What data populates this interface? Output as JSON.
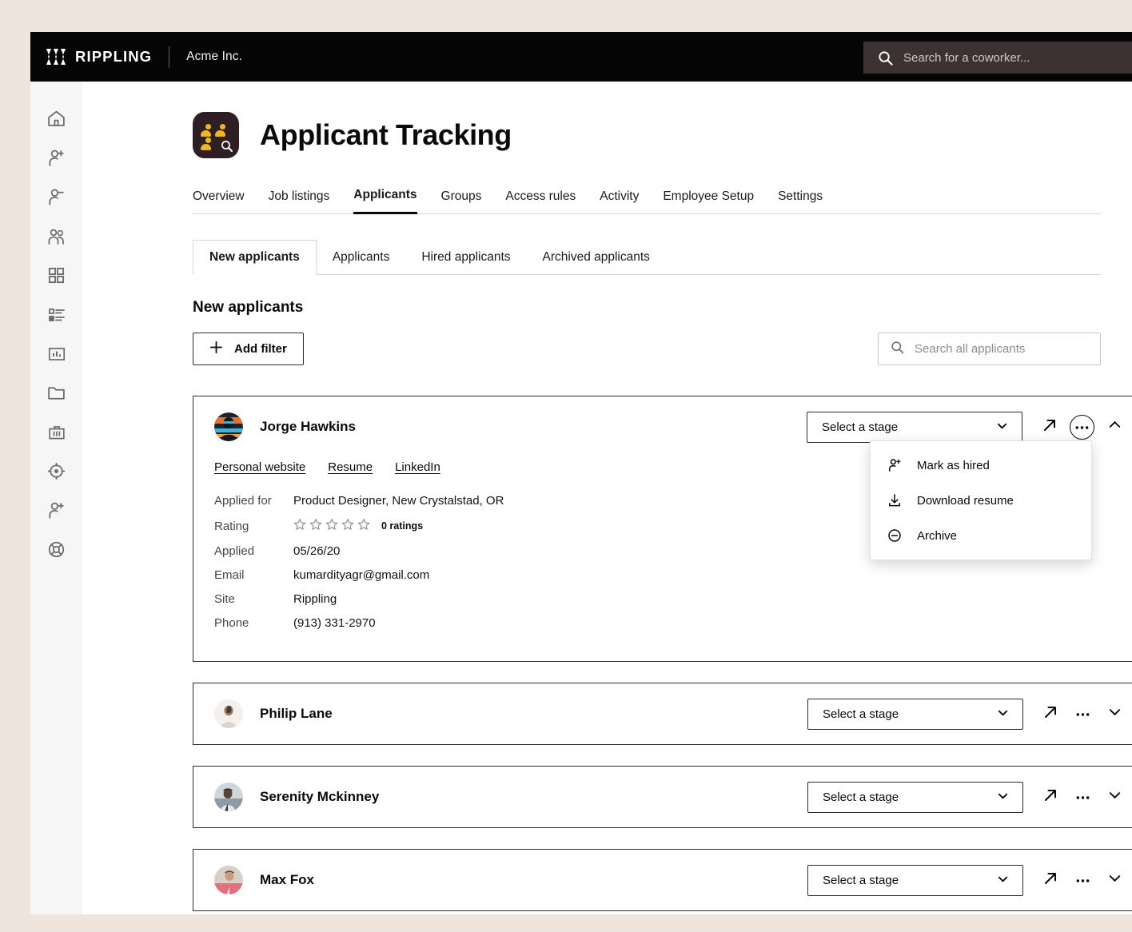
{
  "topbar": {
    "logo_text": "RIPPLING",
    "company": "Acme Inc.",
    "search_placeholder": "Search for a coworker..."
  },
  "sidebar": {
    "items": [
      {
        "name": "home",
        "label": "Home"
      },
      {
        "name": "add-person",
        "label": "Hire"
      },
      {
        "name": "remove-person",
        "label": "Terminate"
      },
      {
        "name": "people",
        "label": "People"
      },
      {
        "name": "apps-grid",
        "label": "Apps"
      },
      {
        "name": "list-tasks",
        "label": "Tasks"
      },
      {
        "name": "reports-chart",
        "label": "Reports"
      },
      {
        "name": "folder",
        "label": "Documents"
      },
      {
        "name": "briefcase",
        "label": "Benefits"
      },
      {
        "name": "target",
        "label": "Goals"
      },
      {
        "name": "add-person-2",
        "label": "Recruiting"
      },
      {
        "name": "lifebuoy",
        "label": "Support"
      }
    ]
  },
  "page": {
    "title": "Applicant Tracking",
    "app_icon_bg": "#2e1f24",
    "app_icon_accent": "#f0b429"
  },
  "nav_tabs": [
    {
      "label": "Overview",
      "active": false
    },
    {
      "label": "Job listings",
      "active": false
    },
    {
      "label": "Applicants",
      "active": true
    },
    {
      "label": "Groups",
      "active": false
    },
    {
      "label": "Access rules",
      "active": false
    },
    {
      "label": "Activity",
      "active": false
    },
    {
      "label": "Employee Setup",
      "active": false
    },
    {
      "label": "Settings",
      "active": false
    }
  ],
  "sub_tabs": [
    {
      "label": "New applicants",
      "active": true
    },
    {
      "label": "Applicants",
      "active": false
    },
    {
      "label": "Hired applicants",
      "active": false
    },
    {
      "label": "Archived applicants",
      "active": false
    }
  ],
  "section": {
    "title": "New applicants",
    "add_filter_label": "Add filter",
    "search_placeholder": "Search all applicants"
  },
  "stage_select_label": "Select a stage",
  "context_menu": {
    "items": [
      {
        "label": "Mark as hired",
        "icon": "person-add-icon"
      },
      {
        "label": "Download resume",
        "icon": "download-icon"
      },
      {
        "label": "Archive",
        "icon": "minus-circle-icon"
      }
    ]
  },
  "applicants": [
    {
      "name": "Jorge Hawkins",
      "expanded": true,
      "links": [
        {
          "label": "Personal website"
        },
        {
          "label": "Resume"
        },
        {
          "label": "LinkedIn"
        }
      ],
      "details": [
        {
          "label": "Applied for",
          "value": "Product Designer, New Crystalstad, OR"
        },
        {
          "label": "Rating",
          "value": "0 ratings",
          "type": "rating",
          "stars": 0,
          "max_stars": 5
        },
        {
          "label": "Applied",
          "value": "05/26/20"
        },
        {
          "label": "Email",
          "value": "kumardityagr@gmail.com"
        },
        {
          "label": "Site",
          "value": "Rippling"
        },
        {
          "label": "Phone",
          "value": "(913) 331-2970"
        }
      ]
    },
    {
      "name": "Philip Lane",
      "expanded": false
    },
    {
      "name": "Serenity Mckinney",
      "expanded": false
    },
    {
      "name": "Max Fox",
      "expanded": false
    }
  ]
}
